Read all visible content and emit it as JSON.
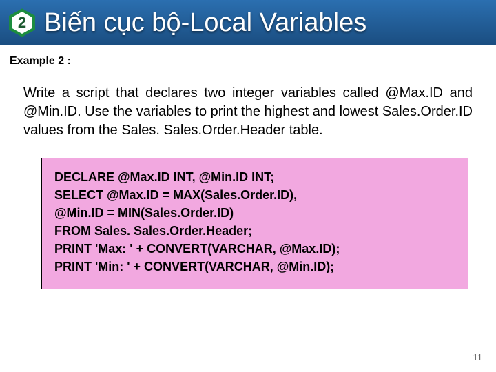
{
  "header": {
    "badge_number": "2",
    "title": "Biến cục bộ-Local Variables"
  },
  "subhead": "Example 2 :",
  "body_text": "Write a script that declares two integer variables called @Max.ID and @Min.ID. Use the variables to print the highest and lowest Sales.Order.ID values from the Sales. Sales.Order.Header table.",
  "code_lines": [
    "DECLARE @Max.ID INT, @Min.ID INT;",
    "SELECT @Max.ID = MAX(Sales.Order.ID),",
    "@Min.ID = MIN(Sales.Order.ID)",
    "FROM Sales. Sales.Order.Header;",
    "PRINT 'Max: ' + CONVERT(VARCHAR, @Max.ID);",
    "PRINT 'Min: ' + CONVERT(VARCHAR, @Min.ID);"
  ],
  "page_number": "11",
  "colors": {
    "header_grad_top": "#2b6fb0",
    "header_grad_bottom": "#1a4d80",
    "hex_outer": "#1d8d3e",
    "hex_inner": "#ffffff",
    "code_bg": "#f2a8e0"
  }
}
